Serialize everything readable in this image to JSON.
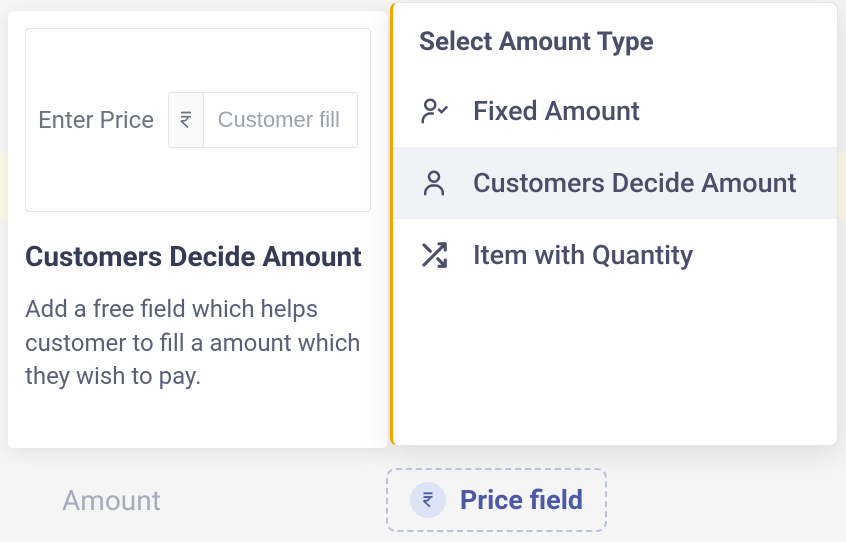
{
  "leftCard": {
    "previewLabel": "Enter Price",
    "inputPlaceholder": "Customer fill",
    "title": "Customers Decide Amount",
    "description": "Add a free field which helps customer to fill a amount which they wish to pay."
  },
  "dropdown": {
    "title": "Select Amount Type",
    "options": [
      {
        "label": "Fixed Amount"
      },
      {
        "label": "Customers Decide Amount"
      },
      {
        "label": "Item with Quantity"
      }
    ]
  },
  "bottom": {
    "amountLabel": "Amount",
    "priceFieldLabel": "Price field"
  }
}
